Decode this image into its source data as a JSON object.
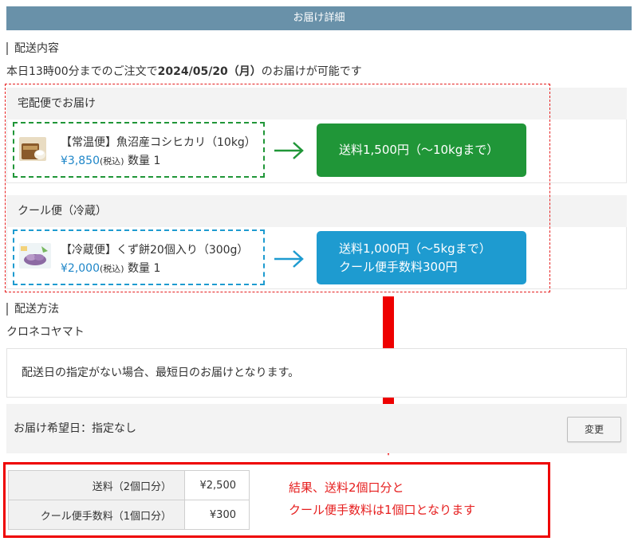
{
  "header": {
    "title": "お届け詳細"
  },
  "shipping_contents": {
    "heading": "配送内容",
    "notice_prefix": "本日13時00分までのご注文で",
    "notice_date": "2024/05/20（月）",
    "notice_suffix": "のお届けが可能です"
  },
  "groups": [
    {
      "title": "宅配便でお届け",
      "item": {
        "name": "【常温便】魚沼産コシヒカリ（10kg）",
        "price": "¥3,850",
        "tax": "(税込)",
        "qty": "数量 1"
      },
      "fee_lines": [
        "送料1,500円（～10kgまで）"
      ],
      "accent": "#209638"
    },
    {
      "title": "クール便（冷蔵）",
      "item": {
        "name": "【冷蔵便】くず餅20個入り（300g）",
        "price": "¥2,000",
        "tax": "(税込)",
        "qty": "数量 1"
      },
      "fee_lines": [
        "送料1,000円（～5kgまで）",
        "クール便手数料300円"
      ],
      "accent": "#1e9bd0"
    }
  ],
  "shipping_method": {
    "heading": "配送方法",
    "carrier": "クロネコヤマト",
    "info": "配送日の指定がない場合、最短日のお届けとなります。",
    "date_label": "お届け希望日：",
    "date_value": "指定なし",
    "change_label": "変更"
  },
  "summary": {
    "rows": [
      {
        "label": "送料（2個口分）",
        "value": "¥2,500"
      },
      {
        "label": "クール便手数料（1個口分）",
        "value": "¥300"
      }
    ],
    "note_lines": [
      "結果、送料2個口分と",
      "クール便手数料は1個口となります"
    ]
  },
  "colors": {
    "header_bg": "#6991a9",
    "annotation_red": "#e61e1e",
    "price_blue": "#1e86c8"
  },
  "icons": [
    "rice-bag-icon",
    "kuzumochi-icon",
    "arrow-right-icon",
    "arrow-down-icon"
  ]
}
